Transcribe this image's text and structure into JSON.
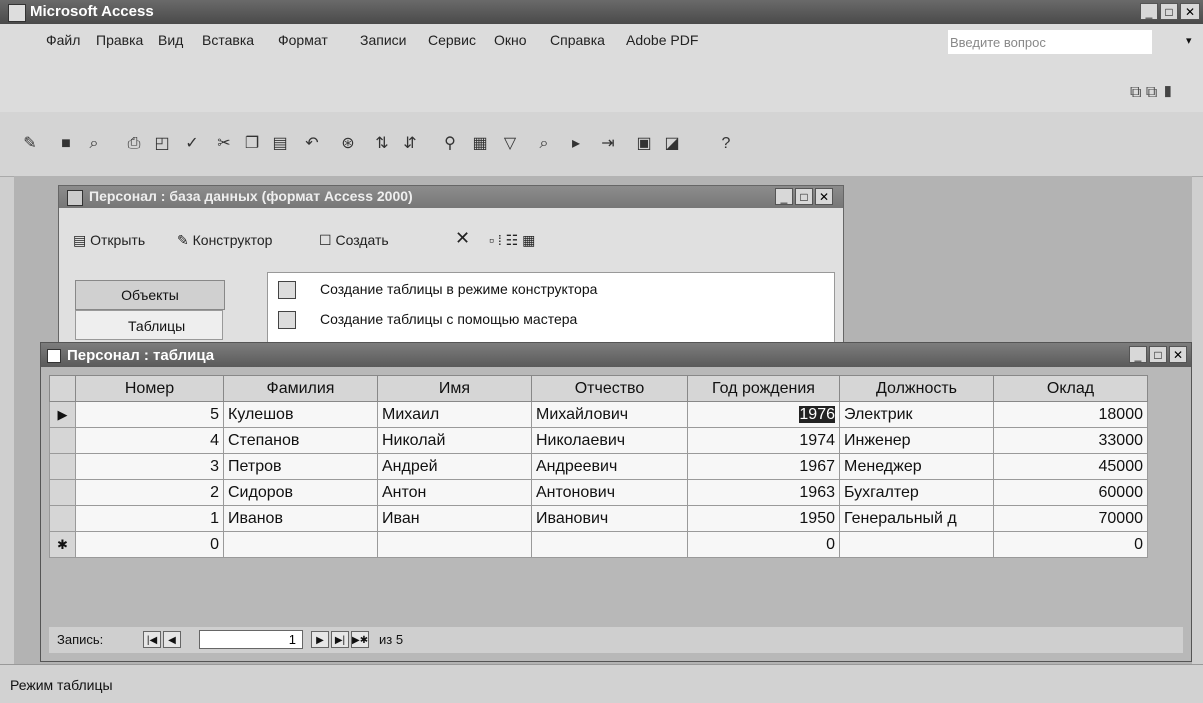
{
  "app": {
    "title": "Microsoft Access"
  },
  "menu": {
    "items": [
      "Файл",
      "Правка",
      "Вид",
      "Вставка",
      "Формат",
      "Записи",
      "Сервис",
      "Окно",
      "Справка",
      "Adobe PDF"
    ],
    "help_placeholder": "Введите вопрос"
  },
  "toolbar": {
    "icons": [
      "view-icon",
      "save-icon",
      "search-file-icon",
      "print-icon",
      "preview-icon",
      "spell-icon",
      "cut-icon",
      "copy-icon",
      "paste-icon",
      "undo-icon",
      "hyperlink-icon",
      "sort-asc-icon",
      "sort-desc-icon",
      "filter-selection-icon",
      "filter-form-icon",
      "apply-filter-icon",
      "find-icon",
      "new-record-icon",
      "delete-record-icon",
      "database-window-icon",
      "new-object-icon",
      "help-icon"
    ]
  },
  "db_window": {
    "title": "Персонал : база данных (формат Access 2000)",
    "tools": {
      "open": "Открыть",
      "design": "Конструктор",
      "create": "Создать"
    },
    "objects_label": "Объекты",
    "tables_label": "Таблицы",
    "list": [
      "Создание таблицы в режиме конструктора",
      "Создание таблицы с помощью мастера"
    ]
  },
  "table_window": {
    "title": "Персонал : таблица",
    "columns": [
      "Номер",
      "Фамилия",
      "Имя",
      "Отчество",
      "Год рождения",
      "Должность",
      "Оклад"
    ],
    "rows": [
      [
        "5",
        "Кулешов",
        "Михаил",
        "Михайлович",
        "1976",
        "Электрик",
        "18000"
      ],
      [
        "4",
        "Степанов",
        "Николай",
        "Николаевич",
        "1974",
        "Инженер",
        "33000"
      ],
      [
        "3",
        "Петров",
        "Андрей",
        "Андреевич",
        "1967",
        "Менеджер",
        "45000"
      ],
      [
        "2",
        "Сидоров",
        "Антон",
        "Антонович",
        "1963",
        "Бухгалтер",
        "60000"
      ],
      [
        "1",
        "Иванов",
        "Иван",
        "Иванович",
        "1950",
        "Генеральный д",
        "70000"
      ]
    ],
    "new_row": [
      "0",
      "",
      "",
      "",
      "0",
      "",
      "0"
    ],
    "nav": {
      "label": "Запись:",
      "current": "1",
      "of_label": "из 5"
    }
  },
  "status": {
    "text": "Режим таблицы"
  }
}
